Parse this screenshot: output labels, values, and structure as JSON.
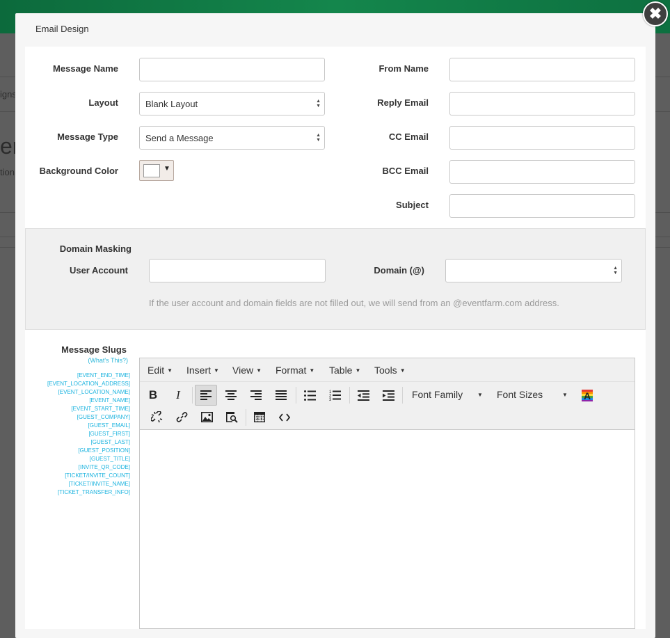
{
  "background": {
    "nav_fragment": "igns",
    "title_fragment": "er",
    "sub_fragment": "tion"
  },
  "modal": {
    "title": "Email Design",
    "close_label": "✖"
  },
  "form": {
    "message_name": {
      "label": "Message Name",
      "value": ""
    },
    "layout": {
      "label": "Layout",
      "value": "Blank Layout"
    },
    "message_type": {
      "label": "Message Type",
      "value": "Send a Message"
    },
    "background_color": {
      "label": "Background Color",
      "value": "#ffffff"
    },
    "from_name": {
      "label": "From Name",
      "value": ""
    },
    "reply_email": {
      "label": "Reply Email",
      "value": ""
    },
    "cc_email": {
      "label": "CC Email",
      "value": ""
    },
    "bcc_email": {
      "label": "BCC Email",
      "value": ""
    },
    "subject": {
      "label": "Subject",
      "value": ""
    }
  },
  "domain_masking": {
    "title": "Domain Masking",
    "user_account": {
      "label": "User Account",
      "value": ""
    },
    "domain": {
      "label": "Domain (@)",
      "value": ""
    },
    "hint": "If the user account and domain fields are not filled out, we will send from an @eventfarm.com address."
  },
  "slugs": {
    "title": "Message Slugs",
    "help_link": "(What's This?)",
    "items": [
      "[EVENT_END_TIME]",
      "[EVENT_LOCATION_ADDRESS]",
      "[EVENT_LOCATION_NAME]",
      "[EVENT_NAME]",
      "[EVENT_START_TIME]",
      "[GUEST_COMPANY]",
      "[GUEST_EMAIL]",
      "[GUEST_FIRST]",
      "[GUEST_LAST]",
      "[GUEST_POSITION]",
      "[GUEST_TITLE]",
      "[INVITE_QR_CODE]",
      "[TICKET/INVITE_COUNT]",
      "[TICKET/INVITE_NAME]",
      "[TICKET_TRANSFER_INFO]"
    ]
  },
  "editor": {
    "menus": [
      "Edit",
      "Insert",
      "View",
      "Format",
      "Table",
      "Tools"
    ],
    "font_family": "Font Family",
    "font_sizes": "Font Sizes",
    "content": "",
    "icons": {
      "bold": "B",
      "italic": "I"
    }
  },
  "colors": {
    "accent": "#1ab3df",
    "topbar": "#14864c"
  }
}
